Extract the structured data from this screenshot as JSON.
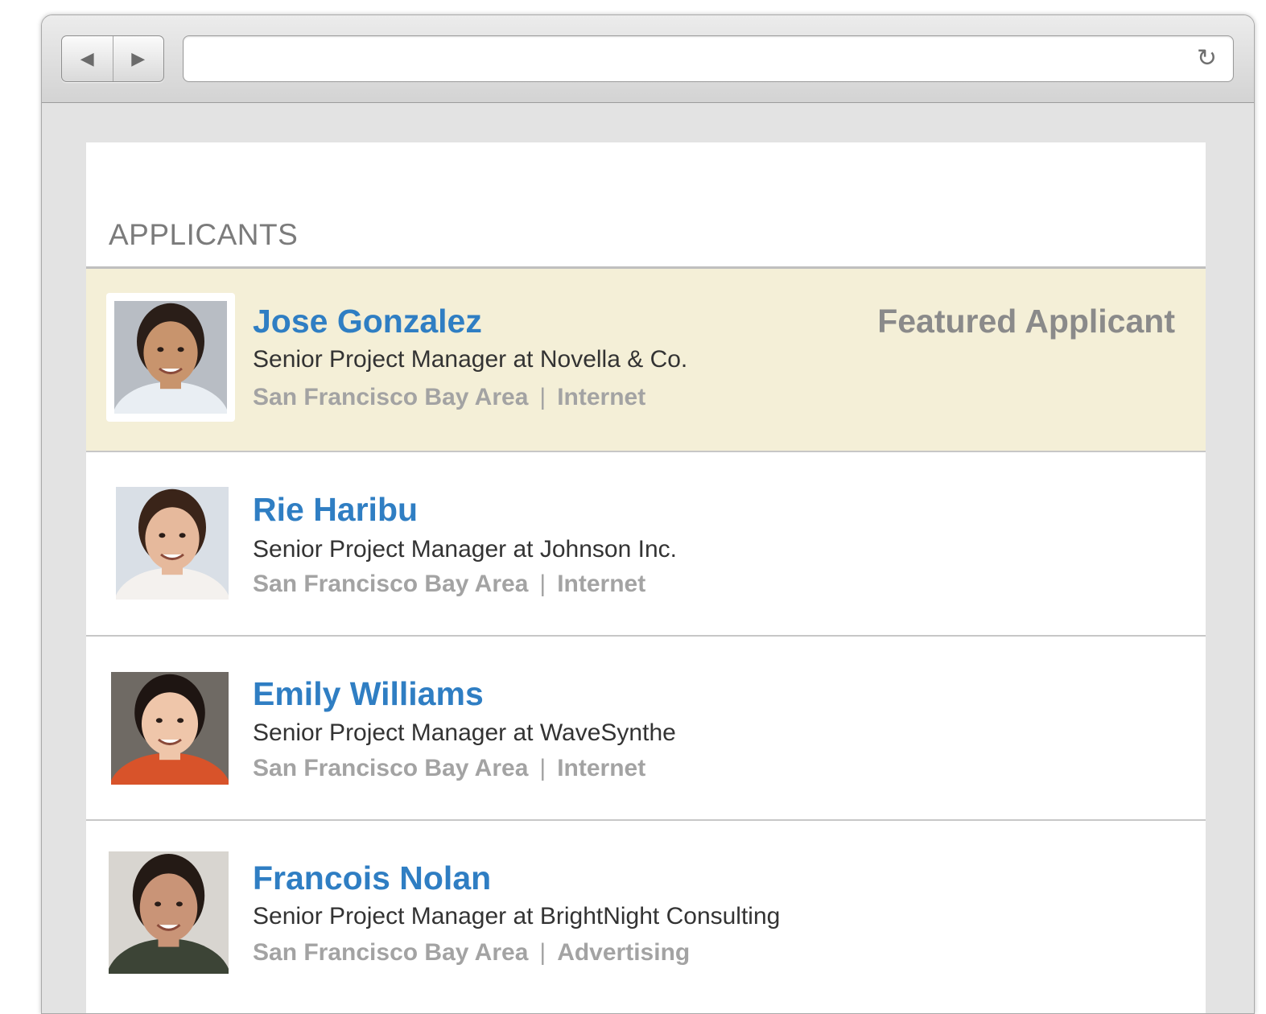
{
  "browser": {
    "back_glyph": "◀",
    "forward_glyph": "▶",
    "address_value": "",
    "reload_glyph": "↻"
  },
  "section": {
    "title": "APPLICANTS"
  },
  "applicants": [
    {
      "name": "Jose Gonzalez",
      "headline": "Senior Project Manager at Novella & Co.",
      "location": "San Francisco Bay Area",
      "industry": "Internet",
      "badge": "Featured Applicant",
      "skin": "#c8946d",
      "hair": "#2a1e18",
      "shirt": "#e9eef3",
      "bg": "#b8bdc4"
    },
    {
      "name": "Rie Haribu",
      "headline": "Senior Project Manager at Johnson Inc.",
      "location": "San Francisco Bay Area",
      "industry": "Internet",
      "skin": "#e6b99c",
      "hair": "#3a2419",
      "shirt": "#f4f1ee",
      "bg": "#d9dfe6"
    },
    {
      "name": "Emily Williams",
      "headline": "Senior Project Manager at WaveSynthe",
      "location": "San Francisco Bay Area",
      "industry": "Internet",
      "skin": "#efc6aa",
      "hair": "#1e1512",
      "shirt": "#d8532a",
      "bg": "#6f6a64"
    },
    {
      "name": "Francois Nolan",
      "headline": "Senior Project Manager at BrightNight Consulting",
      "location": "San Francisco Bay Area",
      "industry": "Advertising",
      "skin": "#c99477",
      "hair": "#241a15",
      "shirt": "#3c4436",
      "bg": "#d8d5d0"
    }
  ]
}
